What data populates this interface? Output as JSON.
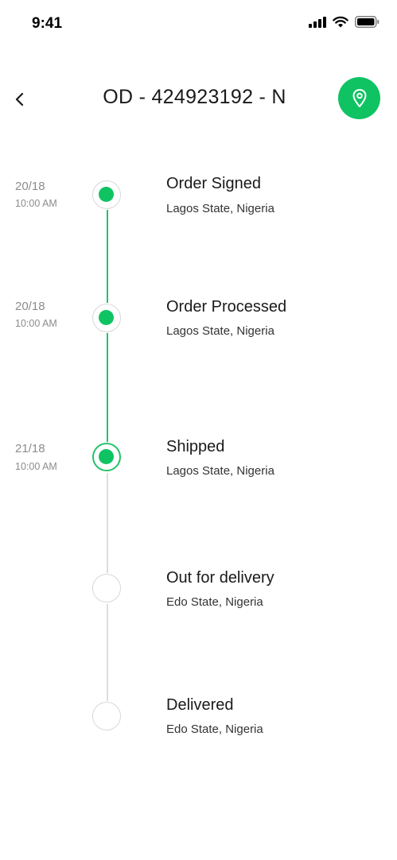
{
  "status_bar": {
    "time": "9:41"
  },
  "header": {
    "title": "OD - 424923192 - N"
  },
  "colors": {
    "accent": "#0fc363",
    "line_done": "#25c26a",
    "line_pending": "#dcdcdc"
  },
  "steps": [
    {
      "title": "Order Signed",
      "location": "Lagos State, Nigeria",
      "date": "20/18",
      "time": "10:00 AM",
      "status": "done"
    },
    {
      "title": "Order Processed",
      "location": "Lagos State, Nigeria",
      "date": "20/18",
      "time": "10:00 AM",
      "status": "done"
    },
    {
      "title": "Shipped",
      "location": "Lagos State, Nigeria",
      "date": "21/18",
      "time": "10:00 AM",
      "status": "current"
    },
    {
      "title": "Out for delivery",
      "location": "Edo State, Nigeria",
      "date": "",
      "time": "",
      "status": "pending"
    },
    {
      "title": "Delivered",
      "location": "Edo State, Nigeria",
      "date": "",
      "time": "",
      "status": "pending"
    }
  ]
}
